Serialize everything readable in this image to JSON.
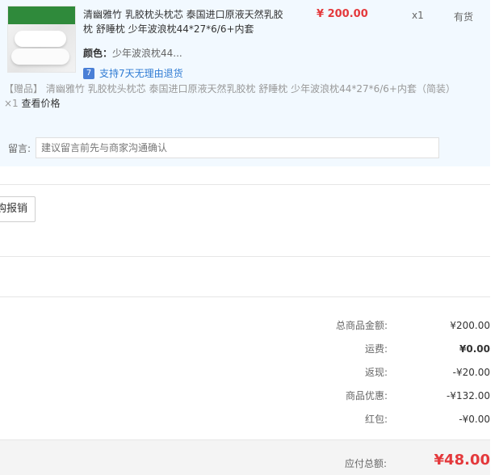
{
  "item": {
    "title": "清幽雅竹 乳胶枕头枕芯 泰国进口原液天然乳胶枕 舒睡枕 少年波浪枕44*27*6/6+内套",
    "price": "¥ 200.00",
    "quantity": "x1",
    "stock": "有货",
    "color_label": "颜色：",
    "color_value": "少年波浪枕44...",
    "return_badge": "7",
    "return_text": "支持7天无理由退货"
  },
  "gift": {
    "text": "【赠品】 清幽雅竹 乳胶枕头枕芯 泰国进口原液天然乳胶枕 舒睡枕 少年波浪枕44*27*6/6+内套（简装）×1",
    "check_price": "查看价格"
  },
  "message": {
    "label": "留言:",
    "placeholder": "建议留言前先与商家沟通确认"
  },
  "invoice": {
    "button_label": "购报销"
  },
  "summary": {
    "rows": [
      {
        "label": "总商品金额:",
        "value": "¥200.00"
      },
      {
        "label": "运费:",
        "value": "¥0.00"
      },
      {
        "label": "返现:",
        "value": "-¥20.00"
      },
      {
        "label": "商品优惠:",
        "value": "-¥132.00"
      },
      {
        "label": "红包:",
        "value": "-¥0.00"
      }
    ],
    "total_label": "应付总额:",
    "total_value": "¥48.00"
  },
  "colors": {
    "accent_red": "#e4393c",
    "link_blue": "#2f7bd3",
    "panel_bg": "#f2f9ff"
  }
}
